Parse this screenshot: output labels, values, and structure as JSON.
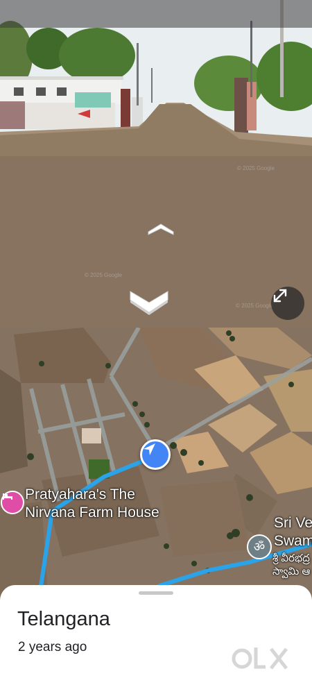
{
  "street_view": {
    "move_forward_icon": "chevron-up-icon",
    "move_back_icon": "chevron-down-icon",
    "expand_icon": "expand-icon",
    "watermarks": [
      "© 2025 Google",
      "© 2025 Google",
      "© 2025 Google"
    ]
  },
  "map": {
    "pois": [
      {
        "name_line1": "Pratyahara's The",
        "name_line2": "Nirvana Farm House",
        "icon": "hotel-icon",
        "color": "#e04da7"
      },
      {
        "name_line1": "Sri Ve",
        "name_line2": "Swam",
        "name_te_line1": "శ్రీ వీరభద్ర",
        "name_te_line2": "స్వామి ఆ",
        "icon": "om-temple-icon",
        "color": "#6f7f86"
      }
    ],
    "location_marker_icon": "navigation-arrow-icon",
    "route_color": "#2aa3e8"
  },
  "sheet": {
    "title": "Telangana",
    "time_ago": "2 years ago",
    "watermark_logo": "OLX"
  }
}
